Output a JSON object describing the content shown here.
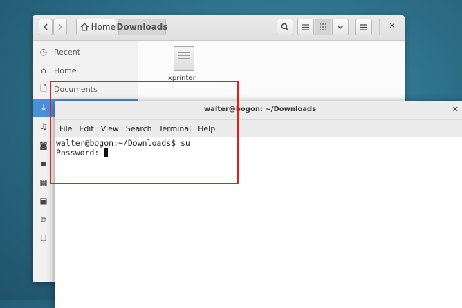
{
  "files_window": {
    "breadcrumb": {
      "home": "Home",
      "current": "Downloads"
    },
    "sidebar": [
      {
        "label": "Recent",
        "icon": "clock-icon"
      },
      {
        "label": "Home",
        "icon": "home-icon"
      },
      {
        "label": "Documents",
        "icon": "document-icon"
      },
      {
        "label": "",
        "icon": "download-icon"
      },
      {
        "label": "",
        "icon": "music-icon"
      },
      {
        "label": "",
        "icon": "camera-icon"
      },
      {
        "label": "",
        "icon": "video-icon"
      },
      {
        "label": "",
        "icon": "calendar-icon"
      },
      {
        "label": "",
        "icon": "disk-icon"
      },
      {
        "label": "",
        "icon": "network-icon"
      },
      {
        "label": "",
        "icon": "computer-icon"
      }
    ],
    "file": {
      "name": "xprinter"
    },
    "accent_color": "#4a90d9"
  },
  "terminal": {
    "title": "walter@bogon: ~/Downloads",
    "menu": [
      "File",
      "Edit",
      "View",
      "Search",
      "Terminal",
      "Help"
    ],
    "lines": [
      "walter@bogon:~/Downloads$ su",
      "Password: "
    ]
  },
  "highlight_color": "#e0201e"
}
